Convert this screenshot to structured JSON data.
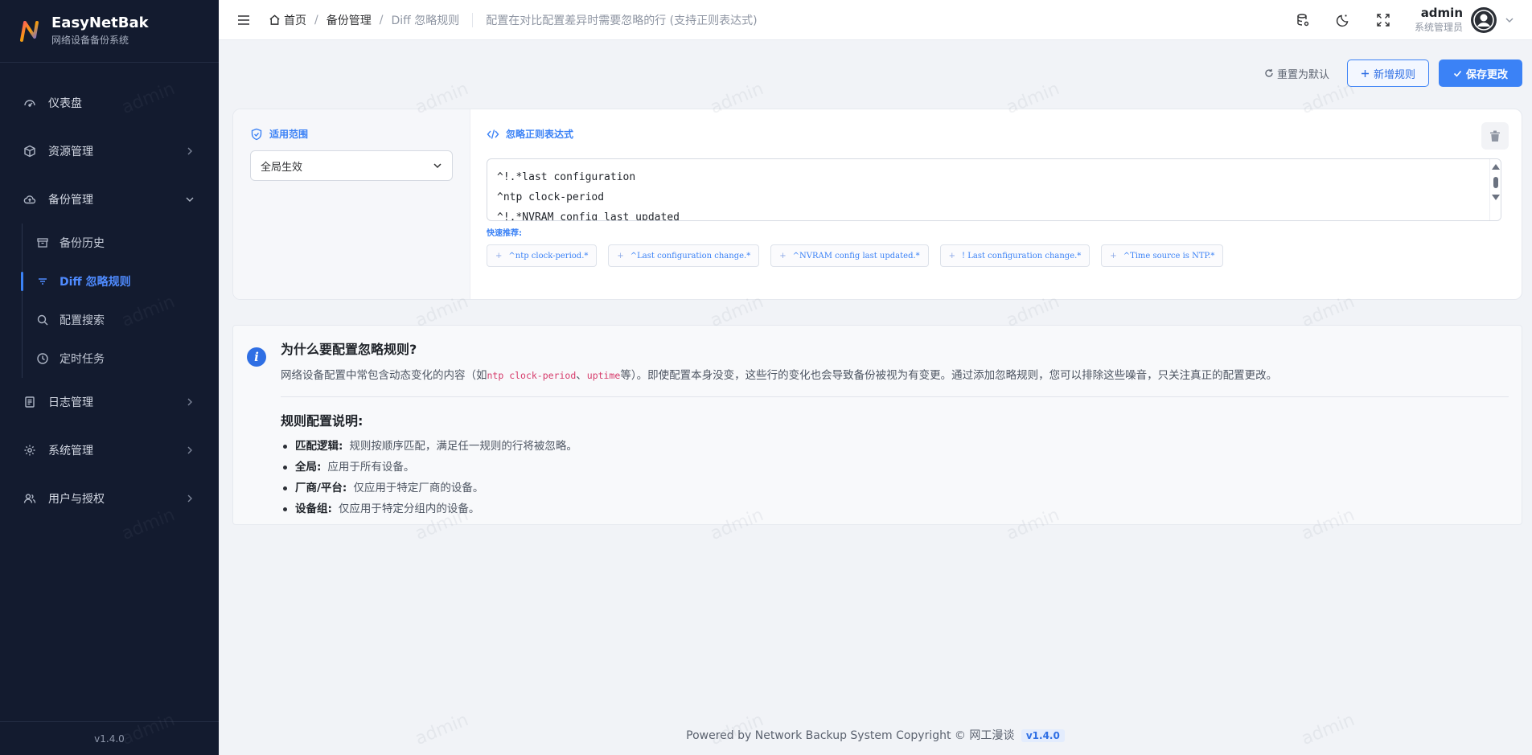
{
  "brand": {
    "name": "EasyNetBak",
    "subtitle": "网络设备备份系统"
  },
  "sidebar": {
    "items": [
      {
        "label": "仪表盘",
        "icon": "dashboard-icon"
      },
      {
        "label": "资源管理",
        "icon": "cube-icon"
      },
      {
        "label": "备份管理",
        "icon": "cloud-upload-icon",
        "expanded": true
      },
      {
        "label": "日志管理",
        "icon": "log-icon"
      },
      {
        "label": "系统管理",
        "icon": "gear-icon"
      },
      {
        "label": "用户与授权",
        "icon": "users-icon"
      }
    ],
    "sub_items": [
      {
        "label": "备份历史",
        "icon": "archive-icon"
      },
      {
        "label": "Diff 忽略规则",
        "icon": "filter-icon",
        "active": true
      },
      {
        "label": "配置搜索",
        "icon": "search-icon"
      },
      {
        "label": "定时任务",
        "icon": "clock-icon"
      }
    ],
    "version": "v1.4.0"
  },
  "header": {
    "breadcrumb": {
      "home": "首页",
      "sep1": "/",
      "parent": "备份管理",
      "sep2": "/",
      "current": "Diff 忽略规则"
    },
    "description": "配置在对比配置差异时需要忽略的行 (支持正则表达式)",
    "user": {
      "name": "admin",
      "role": "系统管理员"
    }
  },
  "toolbar": {
    "reset_label": "重置为默认",
    "add_label": "新增规则",
    "save_label": "保存更改"
  },
  "rule": {
    "scope_title": "适用范围",
    "scope_value": "全局生效",
    "regex_title": "忽略正则表达式",
    "regex_lines": [
      "^!.*last configuration",
      "^ntp clock-period",
      "^!.*NVRAM config last updated"
    ],
    "quick_label": "快速推荐:",
    "chips": [
      "^ntp clock-period.*",
      "^Last configuration change.*",
      "^NVRAM config last updated.*",
      "! Last configuration change.*",
      "^Time source is NTP.*"
    ],
    "chip_plus": "+"
  },
  "info": {
    "title": "为什么要配置忽略规则?",
    "desc_prefix": "网络设备配置中常包含动态变化的内容（如",
    "code1": "ntp clock-period",
    "desc_mid": "、",
    "code2": "uptime",
    "desc_suffix": "等）。即使配置本身没变，这些行的变化也会导致备份被视为有变更。通过添加忽略规则，您可以排除这些噪音，只关注真正的配置更改。",
    "subtitle": "规则配置说明:",
    "list": [
      {
        "term": "匹配逻辑:",
        "text": "规则按顺序匹配，满足任一规则的行将被忽略。"
      },
      {
        "term": "全局:",
        "text": "应用于所有设备。"
      },
      {
        "term": "厂商/平台:",
        "text": "仅应用于特定厂商的设备。"
      },
      {
        "term": "设备组:",
        "text": "仅应用于特定分组内的设备。"
      }
    ]
  },
  "footer": {
    "text": "Powered by Network Backup System Copyright © 网工漫谈",
    "version": "v1.4.0"
  },
  "watermark": "admin",
  "colors": {
    "accent": "#3b82f6",
    "sidebar_bg": "#131b2f",
    "code": "#d63a6a"
  }
}
